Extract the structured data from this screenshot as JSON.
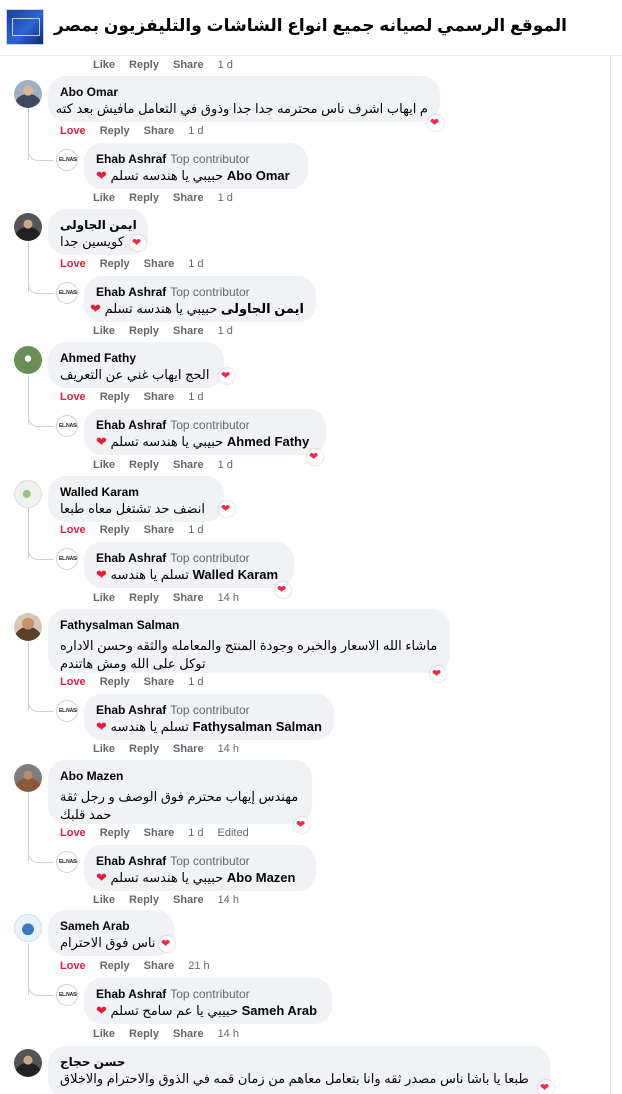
{
  "page_title": "الموقع الرسمي لصيانه جميع انواع الشاشات والتليفزيون بمصر",
  "labels": {
    "like": "Like",
    "love": "Love",
    "reply": "Reply",
    "share": "Share",
    "top_contributor": "Top contributor",
    "edited": "Edited"
  },
  "top_actions": {
    "time": "1 d"
  },
  "comments": [
    {
      "author": "Abo Omar",
      "text": "م ايهاب اشرف ناس محترمه جدا جدا وذوق في التعامل مافيش بعد كته",
      "time": "1 d",
      "reply": {
        "author": "Ehab Ashraf",
        "mention": "Abo Omar",
        "text": "حبيبي يا هندسه تسلم",
        "time": "1 d"
      }
    },
    {
      "author": "ايمن الجاولى",
      "text": "كويسين جدا",
      "time": "1 d",
      "reply": {
        "author": "Ehab Ashraf",
        "mention": "ايمن الجاولى",
        "text": "حبيبي يا هندسه تسلم",
        "time": "1 d"
      }
    },
    {
      "author": "Ahmed Fathy",
      "text": "الحج ايهاب غني عن التعريف",
      "time": "1 d",
      "reply": {
        "author": "Ehab Ashraf",
        "mention": "Ahmed Fathy",
        "text": "حبيبي يا هندسه تسلم",
        "time": "1 d"
      }
    },
    {
      "author": "Walled Karam",
      "text": "انضف حد تشتغل معاه طبعا",
      "time": "1 d",
      "reply": {
        "author": "Ehab Ashraf",
        "mention": "Walled Karam",
        "text": "تسلم يا هندسه",
        "time": "14 h"
      }
    },
    {
      "author": "Fathysalman Salman",
      "text": "ماشاء الله الاسعار والخبره وجودة المنتج والمعامله والثقه وحسن الاداره",
      "text2": "توكل على الله ومش هاتندم",
      "time": "1 d",
      "reply": {
        "author": "Ehab Ashraf",
        "mention": "Fathysalman Salman",
        "text": "تسلم يا هندسه",
        "time": "14 h"
      }
    },
    {
      "author": "Abo Mazen",
      "text": "مهندس إيهاب محترم فوق الوصف و رجل ثقة",
      "text2": "حمد قلبك",
      "time": "1 d",
      "reply": {
        "author": "Ehab Ashraf",
        "mention": "Abo Mazen",
        "text": "حبيبي يا هندسه تسلم",
        "time": "14 h"
      }
    },
    {
      "author": "Sameh Arab",
      "text": "ناس فوق الاحترام",
      "time": "21 h",
      "reply": {
        "author": "Ehab Ashraf",
        "mention": "Sameh Arab",
        "text": "حبيبي يا عم سامح تسلم",
        "time": "14 h"
      }
    },
    {
      "author": "حسن حجاج",
      "text": "طبعا يا باشا ناس مصدر ثقه وانا بتعامل معاهم من زمان قمه في الذوق والاحترام والاخلاق"
    }
  ],
  "colors": {
    "love": "#e41e3f",
    "muted": "#65676b",
    "bubble": "#f0f2f5"
  }
}
